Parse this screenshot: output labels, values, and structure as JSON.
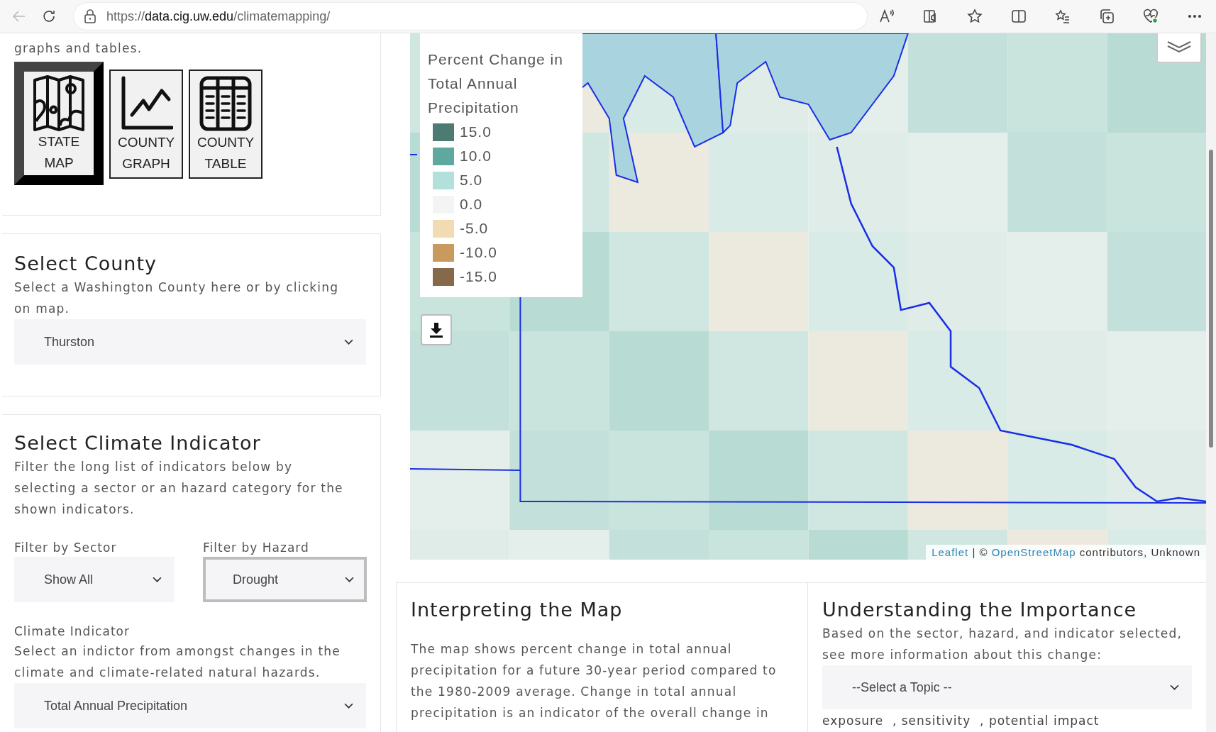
{
  "browser": {
    "url": {
      "scheme": "https://",
      "host": "data.cig.uw.edu",
      "path": "/climatemapping/"
    }
  },
  "view_panel": {
    "intro": "graphs and tables.",
    "views": [
      {
        "kind": "map",
        "label": "STATE MAP",
        "selected": true
      },
      {
        "kind": "graph",
        "label": "COUNTY GRAPH",
        "selected": false
      },
      {
        "kind": "table",
        "label": "COUNTY TABLE",
        "selected": false
      }
    ]
  },
  "county_panel": {
    "title": "Select County",
    "description": "Select a Washington County here or by clicking on map.",
    "select": {
      "value": "Thurston",
      "focused": false
    }
  },
  "indicator_panel": {
    "title": "Select Climate Indicator",
    "description": "Filter the long list of indicators below by selecting a sector or an hazard category for the shown indicators.",
    "filters": [
      {
        "label": "Filter by Sector",
        "value": "Show All",
        "focused": false
      },
      {
        "label": "Filter by Hazard",
        "value": "Drought",
        "focused": true
      }
    ],
    "indicator_label": "Climate Indicator",
    "indicator_description": "Select an indictor from amongst changes in the climate and climate-related natural hazards.",
    "indicator_select": {
      "value": "Total Annual Precipitation",
      "focused": false
    }
  },
  "map": {
    "legend": {
      "title": "Percent Change in Total Annual Precipitation",
      "items": [
        {
          "label": "15.0",
          "color": "#4b7b73"
        },
        {
          "label": "10.0",
          "color": "#5fa89f"
        },
        {
          "label": "5.0",
          "color": "#b2e0da"
        },
        {
          "label": "0.0",
          "color": "#f4f4f4"
        },
        {
          "label": "-5.0",
          "color": "#f0dcb0"
        },
        {
          "label": "-10.0",
          "color": "#c89a5e"
        },
        {
          "label": "-15.0",
          "color": "#86684a"
        }
      ]
    },
    "attribution": {
      "leaflet": "Leaflet",
      "separator": "| ©",
      "osm": "OpenStreetMap",
      "rest": "contributors, Unknown"
    }
  },
  "interpreting": {
    "title": "Interpreting the Map",
    "text": "The map shows percent change in total annual precipitation for a future 30-year period compared to the 1980-2009 average. Change in total annual precipitation is an indicator of the overall change in"
  },
  "importance": {
    "title": "Understanding the Importance",
    "text": "Based on the sector, hazard, and indicator selected, see more information about this change:",
    "select": {
      "value": "--Select a Topic --",
      "focused": false
    },
    "terms": "exposure  , sensitivity  , potential impact"
  }
}
